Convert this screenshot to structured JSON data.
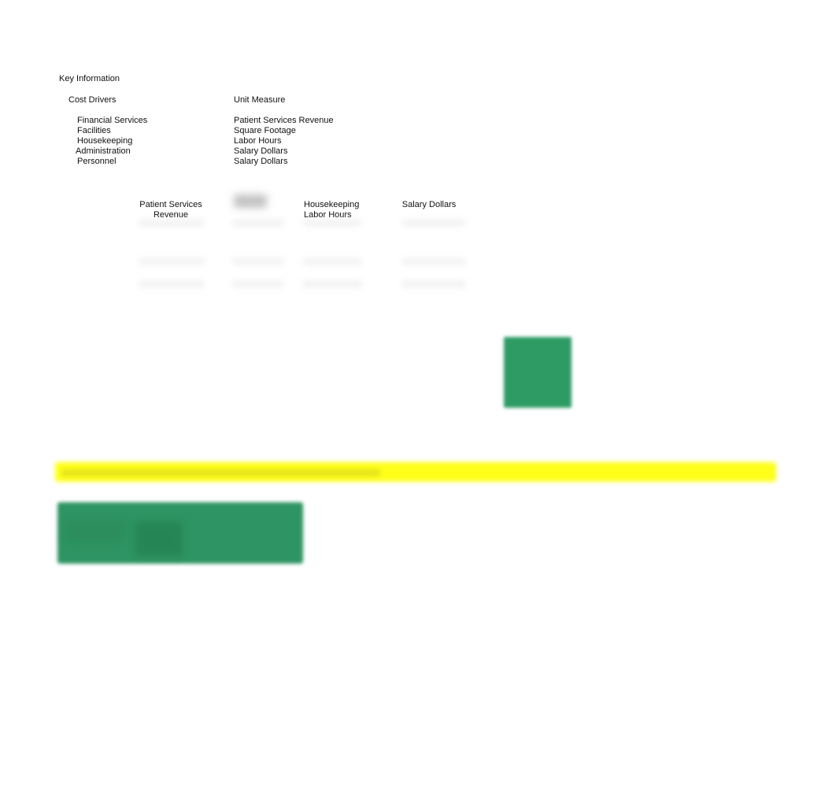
{
  "key_information": {
    "title": "Key Information",
    "cost_drivers_header": "Cost Drivers",
    "unit_measure_header": "Unit Measure",
    "rows": [
      {
        "cost_driver": "Financial Services",
        "unit_measure": "Patient Services Revenue"
      },
      {
        "cost_driver": "Facilities",
        "unit_measure": "Square Footage"
      },
      {
        "cost_driver": "Housekeeping",
        "unit_measure": "Labor Hours"
      },
      {
        "cost_driver": "Administration",
        "unit_measure": "Salary Dollars"
      },
      {
        "cost_driver": "Personnel",
        "unit_measure": "Salary Dollars"
      }
    ]
  },
  "allocation_table": {
    "columns": [
      {
        "line1": "Patient Services",
        "line2": "Revenue"
      },
      {
        "line1": "",
        "line2": "",
        "redacted": true
      },
      {
        "line1": "Housekeeping",
        "line2": "Labor Hours"
      },
      {
        "line1": "Salary Dollars",
        "line2": ""
      }
    ],
    "rows_redacted": 3
  },
  "colors": {
    "green_block": "#2e9b64",
    "highlight_band": "#ffff1a",
    "green_panel": "#2e9463"
  }
}
